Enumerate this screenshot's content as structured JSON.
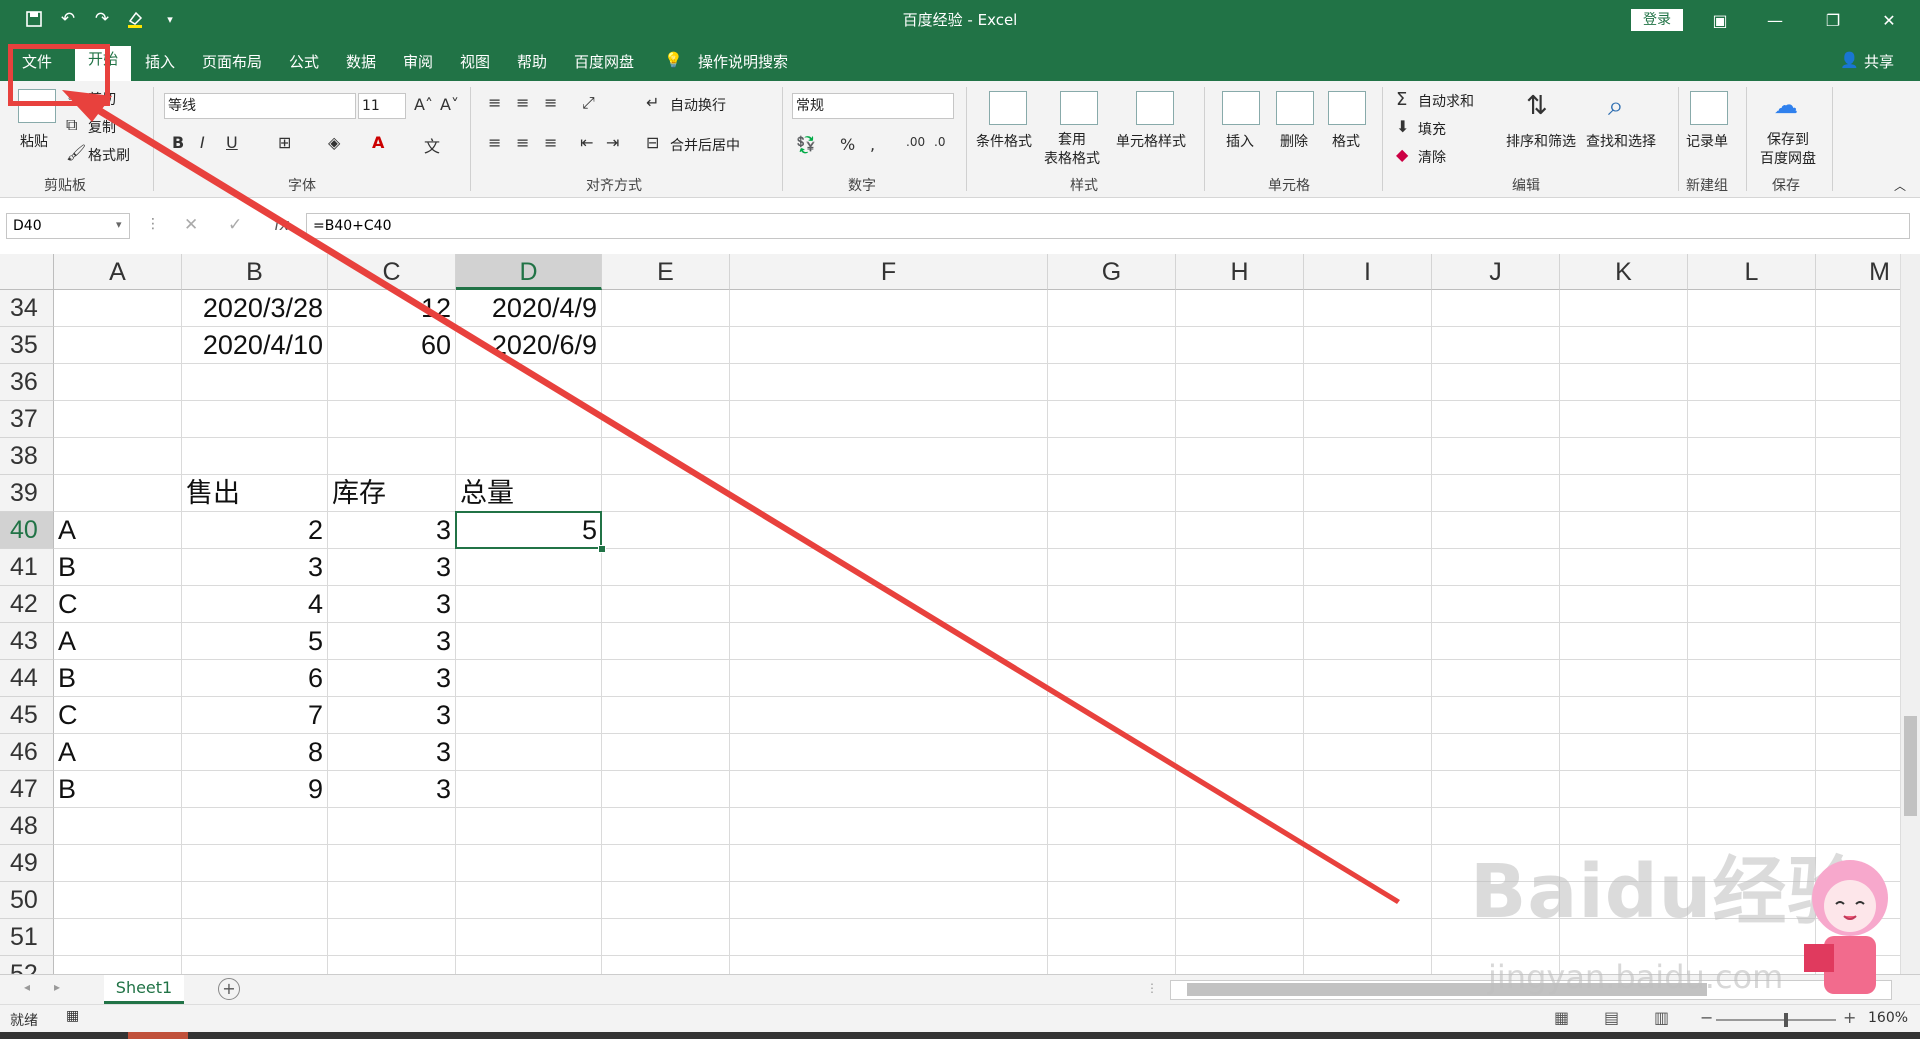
{
  "window": {
    "title": "百度经验 - Excel",
    "login_label": "登录",
    "min_icon": "minimize-icon",
    "max_icon": "restore-icon",
    "close_icon": "close-icon"
  },
  "tabs": [
    "文件",
    "开始",
    "插入",
    "页面布局",
    "公式",
    "数据",
    "审阅",
    "视图",
    "帮助",
    "百度网盘"
  ],
  "tell_me": "操作说明搜索",
  "share_label": "共享",
  "ribbon": {
    "clipboard": {
      "paste": "粘贴",
      "cut": "剪切",
      "copy": "复制",
      "format_painter": "格式刷",
      "group": "剪贴板"
    },
    "font": {
      "name": "等线",
      "size": "11",
      "group": "字体"
    },
    "alignment": {
      "wrap": "自动换行",
      "merge": "合并后居中",
      "group": "对齐方式"
    },
    "number": {
      "format": "常规",
      "group": "数字"
    },
    "styles": {
      "conditional": "条件格式",
      "table": "套用\n表格格式",
      "cell": "单元格样式",
      "group": "样式"
    },
    "cells": {
      "insert": "插入",
      "delete": "删除",
      "format": "格式",
      "group": "单元格"
    },
    "editing": {
      "autosum": "自动求和",
      "fill": "填充",
      "clear": "清除",
      "sort": "排序和筛选",
      "find": "查找和选择",
      "group": "编辑"
    },
    "newgroup": {
      "record": "记录单",
      "group": "新建组"
    },
    "save": {
      "save_to": "保存到\n百度网盘",
      "group": "保存"
    }
  },
  "formula_bar": {
    "name_box": "D40",
    "formula": "=B40+C40"
  },
  "columns": [
    "A",
    "B",
    "C",
    "D",
    "E",
    "F",
    "G",
    "H",
    "I",
    "J",
    "K",
    "L",
    "M"
  ],
  "rows": [
    {
      "n": "34",
      "A": "",
      "B": "2020/3/28",
      "C": "12",
      "D": "2020/4/9"
    },
    {
      "n": "35",
      "A": "",
      "B": "2020/4/10",
      "C": "60",
      "D": "2020/6/9"
    },
    {
      "n": "36",
      "A": "",
      "B": "",
      "C": "",
      "D": ""
    },
    {
      "n": "37",
      "A": "",
      "B": "",
      "C": "",
      "D": ""
    },
    {
      "n": "38",
      "A": "",
      "B": "",
      "C": "",
      "D": ""
    },
    {
      "n": "39",
      "A": "",
      "B": "售出",
      "C": "库存",
      "D": "总量"
    },
    {
      "n": "40",
      "A": "A",
      "B": "2",
      "C": "3",
      "D": "5"
    },
    {
      "n": "41",
      "A": "B",
      "B": "3",
      "C": "3",
      "D": ""
    },
    {
      "n": "42",
      "A": "C",
      "B": "4",
      "C": "3",
      "D": ""
    },
    {
      "n": "43",
      "A": "A",
      "B": "5",
      "C": "3",
      "D": ""
    },
    {
      "n": "44",
      "A": "B",
      "B": "6",
      "C": "3",
      "D": ""
    },
    {
      "n": "45",
      "A": "C",
      "B": "7",
      "C": "3",
      "D": ""
    },
    {
      "n": "46",
      "A": "A",
      "B": "8",
      "C": "3",
      "D": ""
    },
    {
      "n": "47",
      "A": "B",
      "B": "9",
      "C": "3",
      "D": ""
    },
    {
      "n": "48",
      "A": "",
      "B": "",
      "C": "",
      "D": ""
    },
    {
      "n": "49",
      "A": "",
      "B": "",
      "C": "",
      "D": ""
    },
    {
      "n": "50",
      "A": "",
      "B": "",
      "C": "",
      "D": ""
    },
    {
      "n": "51",
      "A": "",
      "B": "",
      "C": "",
      "D": ""
    },
    {
      "n": "52",
      "A": "",
      "B": "",
      "C": "",
      "D": ""
    }
  ],
  "selected": {
    "col": "D",
    "row": "40"
  },
  "sheet_tab": "Sheet1",
  "status": {
    "ready": "就绪",
    "zoom": "160%"
  },
  "watermark": {
    "logo": "Baidu经验",
    "url": "jingyan.baidu.com"
  },
  "colors": {
    "excel_green": "#217346",
    "annotation_red": "#e8413d"
  }
}
